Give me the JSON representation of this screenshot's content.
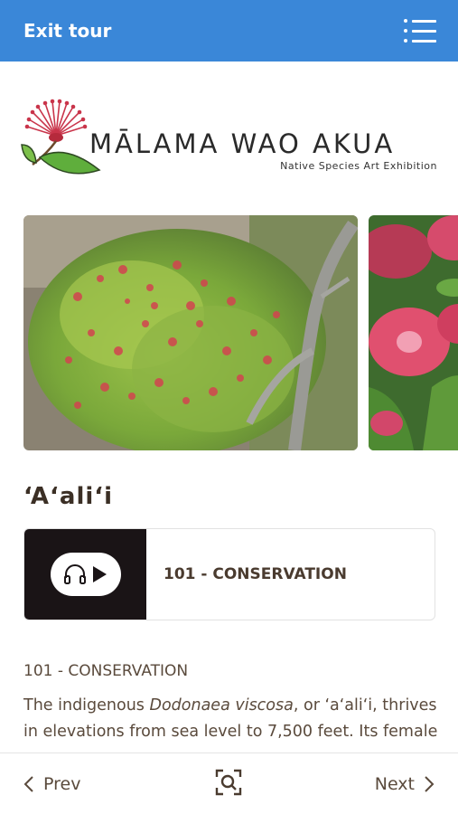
{
  "header": {
    "exit_label": "Exit tour",
    "menu_icon": "menu-list-icon",
    "bg_color": "#3a87d8"
  },
  "logo": {
    "title": "MĀLAMA WAO AKUA",
    "subtitle": "Native Species Art Exhibition",
    "icon": "lehua-flower-logo"
  },
  "gallery": {
    "images": [
      {
        "name": "aalii-shrub-photo"
      },
      {
        "name": "pink-flower-photo"
      }
    ]
  },
  "species": {
    "title": "ʻAʻaliʻi"
  },
  "audio_card": {
    "label": "101 - CONSERVATION",
    "icons": [
      "headphones-icon",
      "play-icon"
    ]
  },
  "content": {
    "heading": "101 - CONSERVATION",
    "text_before": "The indigenous ",
    "text_italic": "Dodonaea viscosa",
    "text_after": ", or ‘a‘ali‘i, thrives in elevations from sea level to 7,500 feet. Its female"
  },
  "footer": {
    "prev_label": "Prev",
    "next_label": "Next",
    "scan_icon": "scan-search-icon"
  }
}
